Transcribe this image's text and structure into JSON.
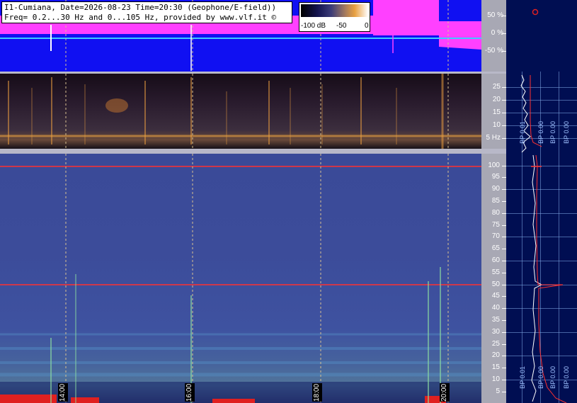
{
  "header": {
    "line1": "I1-Cumiana, Date=2026-08-23 Time=20:30 (Geophone/E-field))",
    "line2": "Freq= 0.2...30 Hz and 0...105 Hz, provided by www.vlf.it ©"
  },
  "color_scale": {
    "labels": [
      "-100 dB",
      "-50",
      "0"
    ],
    "gradient": [
      "#000000",
      "#141450",
      "#3c3c78",
      "#a07860",
      "#e8a040",
      "#ffffff"
    ]
  },
  "waveform_axis": {
    "labels": [
      "50 %",
      "0 %",
      "-50 %"
    ]
  },
  "spectrogram_low": {
    "axis_labels": [
      "25",
      "20",
      "15",
      "10",
      "5 Hz"
    ]
  },
  "spectrogram_high": {
    "axis_labels": [
      "100",
      "95",
      "90",
      "85",
      "80",
      "75",
      "70",
      "65",
      "60",
      "55",
      "50",
      "45",
      "40",
      "35",
      "30",
      "25",
      "20",
      "15",
      "10",
      "5"
    ]
  },
  "time_markers": [
    "14:00",
    "16:00",
    "18:00",
    "20:00"
  ],
  "spectrum_panel": {
    "mid_labels": [
      "BP 0.01",
      "BP 0.00",
      "BP 0.00",
      "BP 0.00"
    ],
    "bot_labels": [
      "BP 0.01",
      "BP 0.00",
      "BP 0.00",
      "BP 0.00"
    ]
  },
  "colors": {
    "waveform_bg": "#1010f2",
    "waveform_signal": "#ff40ff",
    "waveform_trace": "#40c8ff",
    "panel_bg": "#000e52",
    "axis_bg": "#a8a8b4",
    "hum_line": "#ff3030"
  }
}
